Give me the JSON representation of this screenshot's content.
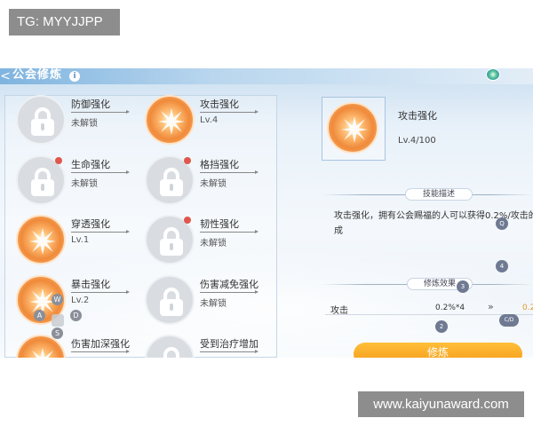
{
  "watermarks": {
    "top_left": "TG: MYYJJPP",
    "bottom_right": "www.kaiyunaward.com"
  },
  "header": {
    "back_glyph": "<",
    "title": "公会修炼",
    "info_icon": "i"
  },
  "skills": [
    {
      "name": "防御强化",
      "status": "未解锁",
      "state": "locked",
      "has_red_dot": false
    },
    {
      "name": "攻击强化",
      "status": "Lv.4",
      "state": "unlocked",
      "has_red_dot": false
    },
    {
      "name": "生命强化",
      "status": "未解锁",
      "state": "locked",
      "has_red_dot": true
    },
    {
      "name": "格挡强化",
      "status": "未解锁",
      "state": "locked",
      "has_red_dot": true
    },
    {
      "name": "穿透强化",
      "status": "Lv.1",
      "state": "unlocked",
      "has_red_dot": false
    },
    {
      "name": "韧性强化",
      "status": "未解锁",
      "state": "locked",
      "has_red_dot": true
    },
    {
      "name": "暴击强化",
      "status": "Lv.2",
      "state": "unlocked",
      "has_red_dot": false
    },
    {
      "name": "伤害减免强化",
      "status": "未解锁",
      "state": "locked",
      "has_red_dot": false
    },
    {
      "name": "伤害加深强化",
      "status": "",
      "state": "unlocked",
      "has_red_dot": false
    },
    {
      "name": "受到治疗增加",
      "status": "",
      "state": "locked",
      "has_red_dot": false
    }
  ],
  "detail": {
    "name": "攻击强化",
    "level": "Lv.4/100",
    "desc_tab": "技能描述",
    "desc_line1": "攻击强化，拥有公会赐福的人可以获得0.2%/攻击的",
    "desc_line2": "成",
    "effect_tab": "修炼效果",
    "effect_label": "攻击",
    "effect_value": "0.2%*4",
    "effect_arrow": "»",
    "effect_next": "0.2",
    "train_button": "修炼"
  },
  "overlay_badges": [
    "Q",
    "4",
    "3",
    "2",
    "C/D"
  ],
  "dpad": {
    "up": "W",
    "left": "A",
    "right": "D",
    "down": "S"
  },
  "colors": {
    "accent_orange": "#f59a18",
    "skill_orange": "#f08a3a",
    "red_dot": "#e0574c",
    "header_blue": "#7fb4df"
  }
}
